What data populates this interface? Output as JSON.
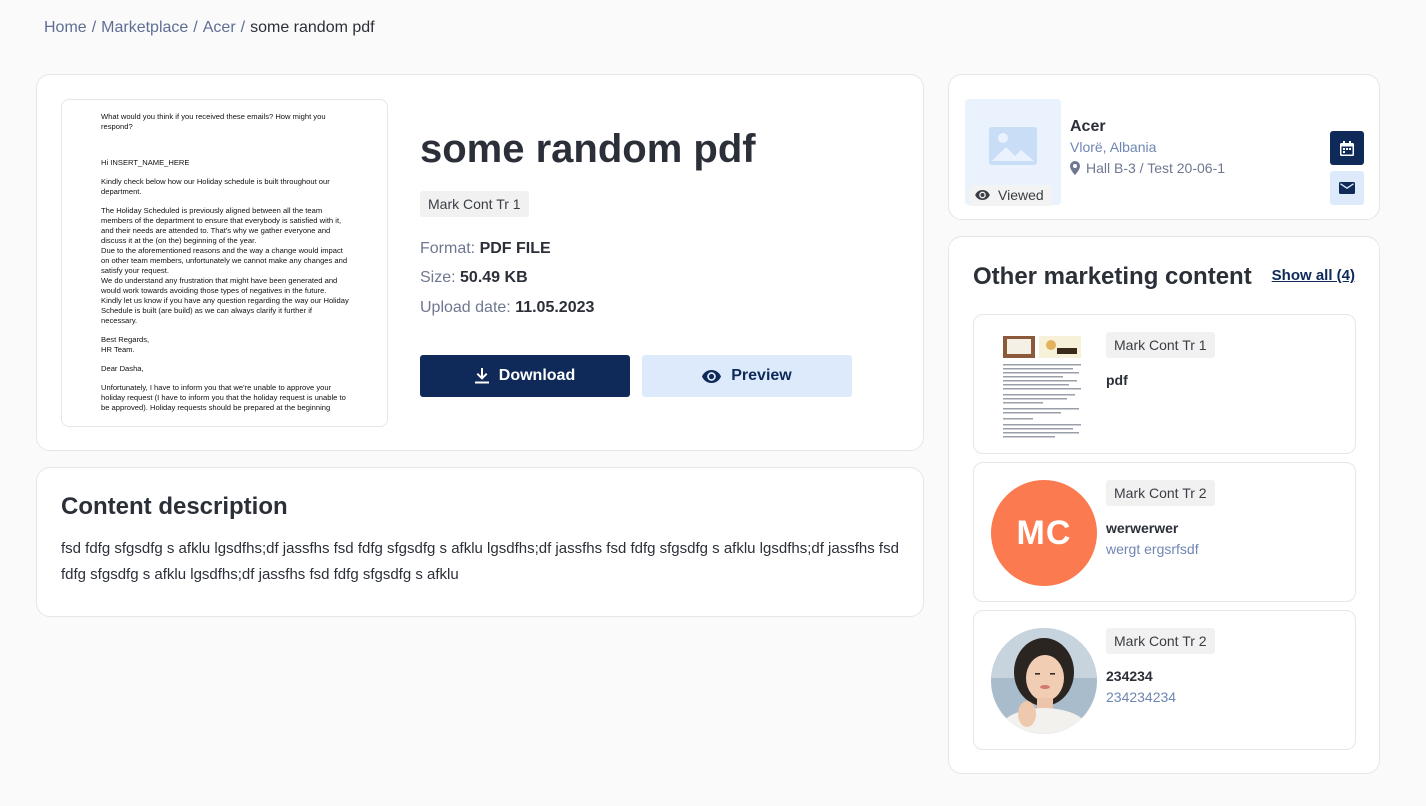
{
  "breadcrumb": {
    "items": [
      "Home",
      "Marketplace",
      "Acer"
    ],
    "current": "some random pdf",
    "separator": "/"
  },
  "document": {
    "title": "some random pdf",
    "tag": "Mark Cont Tr 1",
    "format_label": "Format:",
    "format_value": "PDF FILE",
    "size_label": "Size:",
    "size_value": "50.49 KB",
    "date_label": "Upload date:",
    "date_value": "11.05.2023",
    "download_label": "Download",
    "preview_label": "Preview",
    "pdf_preview": {
      "p1": "What would you think if you received these emails? How might you respond?",
      "p2": "Hi INSERT_NAME_HERE",
      "p3": "Kindly check below how our Holiday schedule is built throughout our department.",
      "p4a": "The Holiday Scheduled is previously aligned between all the team members of the department to ensure that everybody is satisfied with it, and their needs are attended to. That's why we gather everyone and discuss it at the (on the) beginning of the year.",
      "p4b": "Due to the aforementioned reasons and the way a change would impact on other team members, unfortunately we cannot make any changes and satisfy your request.",
      "p4c": "We do understand any frustration that might have been generated and would work towards avoiding those types of negatives in the future.",
      "p4d": "Kindly let us know if you have any question regarding the way our Holiday Schedule is built (are build) as we can always clarify it further if necessary.",
      "p5a": "Best Regards,",
      "p5b": "HR Team.",
      "p6": "Dear Dasha,",
      "p7": "Unfortunately, I have to inform you that we're unable to approve your holiday request (I have to inform you that the holiday request is unable to be approved). Holiday requests should be prepared at the beginning"
    }
  },
  "description": {
    "title": "Content description",
    "text": "fsd fdfg sfgsdfg s afklu lgsdfhs;df jassfhs fsd fdfg sfgsdfg s afklu lgsdfhs;df jassfhs fsd fdfg sfgsdfg s afklu lgsdfhs;df jassfhs fsd fdfg sfgsdfg s afklu lgsdfhs;df jassfhs fsd fdfg sfgsdfg s afklu"
  },
  "vendor": {
    "name": "Acer",
    "location": "Vlorë, Albania",
    "hall": "Hall B-3 / Test 20-06-1",
    "viewed_label": "Viewed"
  },
  "other_content": {
    "title": "Other marketing content",
    "show_all": "Show all (4)",
    "items": [
      {
        "tag": "Mark Cont Tr 1",
        "name": "pdf",
        "subtitle": ""
      },
      {
        "tag": "Mark Cont Tr 2",
        "name": "werwerwer",
        "subtitle": "wergt ergsrfsdf",
        "avatar_text": "MC"
      },
      {
        "tag": "Mark Cont Tr 2",
        "name": "234234",
        "subtitle": "234234234"
      }
    ]
  },
  "colors": {
    "primary": "#0f2a58",
    "primary_light": "#dceafc",
    "avatar_orange": "#fb7a4f",
    "muted_blue": "#6f86b3"
  }
}
